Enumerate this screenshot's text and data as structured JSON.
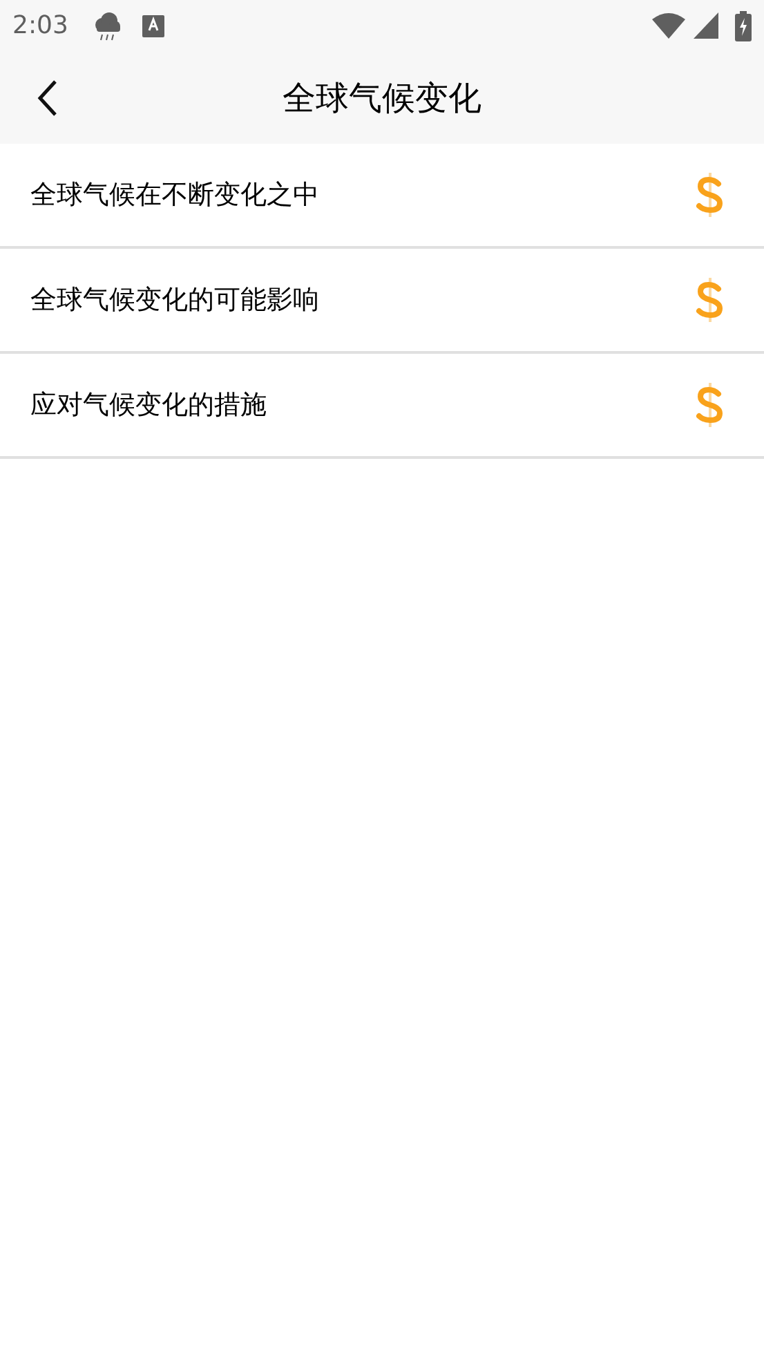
{
  "status_bar": {
    "time": "2:03"
  },
  "header": {
    "title": "全球气候变化"
  },
  "items": [
    {
      "label": "全球气候在不断变化之中"
    },
    {
      "label": "全球气候变化的可能影响"
    },
    {
      "label": "应对气候变化的措施"
    }
  ]
}
